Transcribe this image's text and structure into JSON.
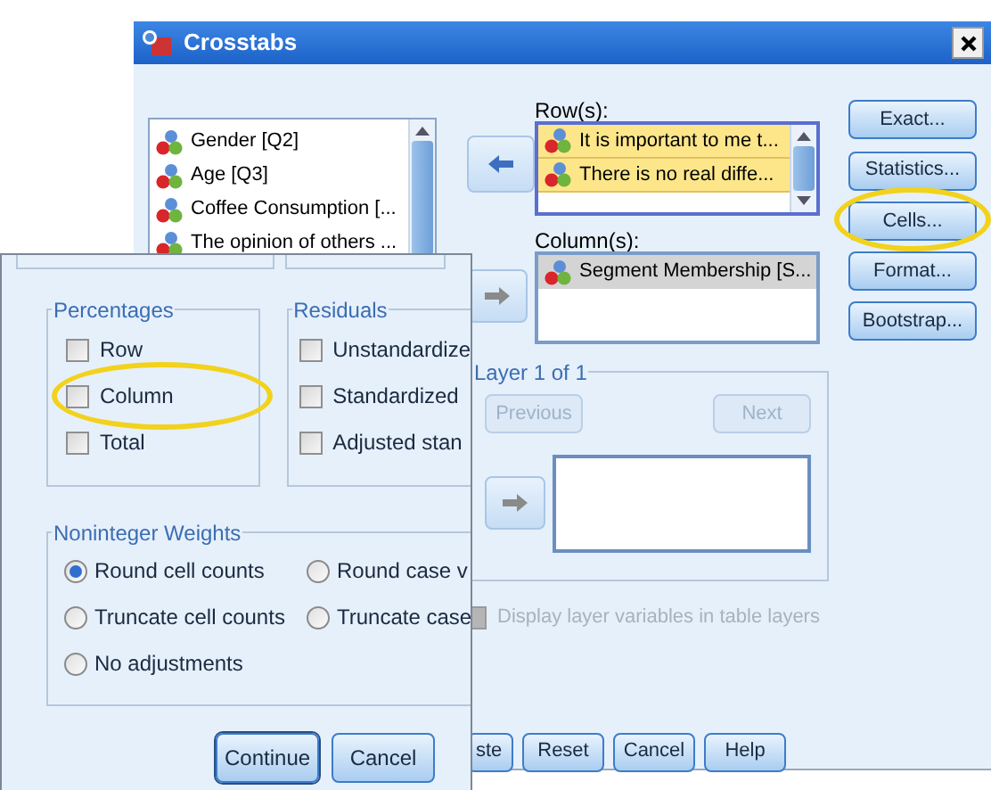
{
  "main_window": {
    "title": "Crosstabs",
    "variables": [
      "Gender [Q2]",
      "Age [Q3]",
      "Coffee Consumption [...",
      "The opinion of others ..."
    ],
    "rows": {
      "label": "Row(s):",
      "focused": true,
      "items": [
        {
          "name": "It is important to me t...",
          "selected": true
        },
        {
          "name": "There is no real diffe...",
          "selected": true
        }
      ]
    },
    "columns": {
      "label": "Column(s):",
      "focused": false,
      "items": [
        {
          "name": "Segment Membership [S...",
          "selected": true
        }
      ]
    },
    "side_buttons": [
      {
        "label": "Exact...",
        "highlighted": false
      },
      {
        "label": "Statistics...",
        "highlighted": false
      },
      {
        "label": "Cells...",
        "highlighted": true
      },
      {
        "label": "Format...",
        "highlighted": false
      },
      {
        "label": "Bootstrap...",
        "highlighted": false
      }
    ],
    "layer": {
      "title": "Layer 1 of 1",
      "previous": {
        "label": "Previous",
        "disabled": true
      },
      "next": {
        "label": "Next",
        "disabled": true
      }
    },
    "display_layer": {
      "label": "Display layer variables in table layers",
      "checked": false,
      "disabled": true
    },
    "buttons": [
      "ste",
      "Reset",
      "Cancel",
      "Help"
    ]
  },
  "cells_dialog": {
    "percentages": {
      "title": "Percentages",
      "options": [
        {
          "label": "Row",
          "checked": false,
          "highlighted": false
        },
        {
          "label": "Column",
          "checked": false,
          "highlighted": true
        },
        {
          "label": "Total",
          "checked": false,
          "highlighted": false
        }
      ]
    },
    "residuals": {
      "title": "Residuals",
      "options": [
        {
          "label": "Unstandardize",
          "checked": false,
          "highlighted": false
        },
        {
          "label": "Standardized",
          "checked": false,
          "highlighted": false
        },
        {
          "label": "Adjusted stan",
          "checked": false,
          "highlighted": false
        }
      ]
    },
    "weights": {
      "title": "Noninteger Weights",
      "options": [
        {
          "label": "Round cell counts",
          "selected": true
        },
        {
          "label": "Round case v",
          "selected": false
        },
        {
          "label": "Truncate cell counts",
          "selected": false
        },
        {
          "label": "Truncate case",
          "selected": false
        },
        {
          "label": "No adjustments",
          "selected": false
        }
      ]
    },
    "buttons": [
      {
        "label": "Continue",
        "default": true
      },
      {
        "label": "Cancel",
        "default": false
      }
    ]
  }
}
